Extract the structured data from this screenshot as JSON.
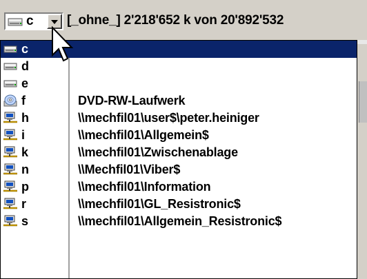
{
  "drive_selector": {
    "selected_letter": "c",
    "volume_label": "[_ohne_]",
    "free_space": "2'218'652 k",
    "of_word": "von",
    "total_space": "20'892'532"
  },
  "drives": [
    {
      "letter": "c",
      "path": "",
      "icon": "hard-drive-icon",
      "selected": true
    },
    {
      "letter": "d",
      "path": "",
      "icon": "hard-drive-icon",
      "selected": false
    },
    {
      "letter": "e",
      "path": "",
      "icon": "hard-drive-icon",
      "selected": false
    },
    {
      "letter": "f",
      "path": "DVD-RW-Laufwerk",
      "icon": "optical-drive-icon",
      "selected": false
    },
    {
      "letter": "h",
      "path": "\\\\mechfil01\\user$\\peter.heiniger",
      "icon": "network-drive-icon",
      "selected": false
    },
    {
      "letter": "i",
      "path": "\\\\mechfil01\\Allgemein$",
      "icon": "network-drive-icon",
      "selected": false
    },
    {
      "letter": "k",
      "path": "\\\\mechfil01\\Zwischenablage",
      "icon": "network-drive-icon",
      "selected": false
    },
    {
      "letter": "n",
      "path": "\\\\Mechfil01\\Viber$",
      "icon": "network-drive-icon",
      "selected": false
    },
    {
      "letter": "p",
      "path": "\\\\mechfil01\\Information",
      "icon": "network-drive-icon",
      "selected": false
    },
    {
      "letter": "r",
      "path": "\\\\mechfil01\\GL_Resistronic$",
      "icon": "network-drive-icon",
      "selected": false
    },
    {
      "letter": "s",
      "path": "\\\\mechfil01\\Allgemein_Resistronic$",
      "icon": "network-drive-icon",
      "selected": false
    }
  ],
  "colors": {
    "selection": "#0a246a",
    "window_bg": "#d4d0c8"
  }
}
